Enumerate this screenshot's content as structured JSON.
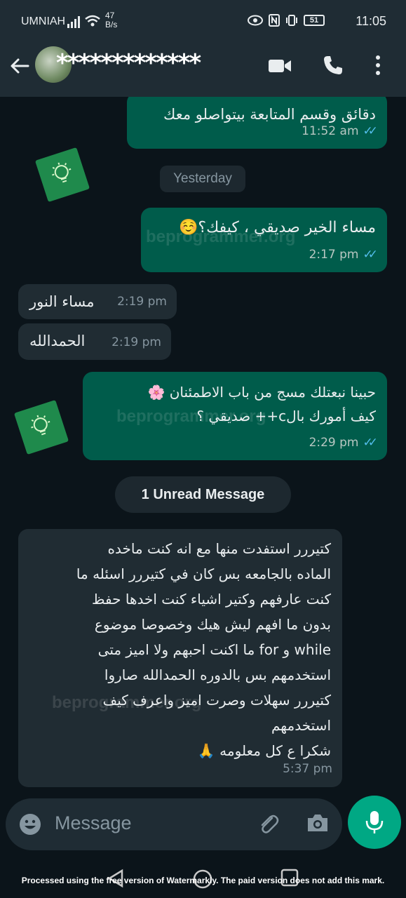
{
  "status_bar": {
    "carrier": "UMNIAH",
    "speed_value": "47",
    "speed_unit": "B/s",
    "battery": "51",
    "time": "11:05"
  },
  "header": {
    "contact_name": "*************",
    "back_icon": "arrow-left-icon",
    "video_icon": "video-call-icon",
    "phone_icon": "phone-icon",
    "menu_icon": "more-vert-icon"
  },
  "messages": [
    {
      "direction": "out",
      "text": "دقائق وقسم المتابعة بيتواصلو معك",
      "time": "11:52 am",
      "status": "read"
    },
    {
      "direction": "out",
      "text": "مساء الخير صديقي ، كيفك؟☺️",
      "time": "2:17 pm",
      "status": "read"
    },
    {
      "direction": "in",
      "text": "مساء النور",
      "time": "2:19 pm"
    },
    {
      "direction": "in",
      "text": "الحمدالله",
      "time": "2:19 pm"
    },
    {
      "direction": "out",
      "text_line1": "حبينا نبعتلك مسج من باب الاطمئنان 🌸",
      "text_line2": "كيف أمورك بالc++ صديقي ؟",
      "time": "2:29 pm",
      "status": "read"
    },
    {
      "direction": "in",
      "lines": [
        "كتيررر استفدت منها مع انه كنت ماخده",
        "الماده بالجامعه بس كان في كتيررر اسئله ما",
        "كنت عارفهم وكتير اشياء كنت اخدها حفظ",
        "بدون ما افهم ليش هيك  وخصوصا موضوع",
        "while  و  for   ما اكنت احبهم ولا اميز متى",
        "استخدمهم بس بالدوره الحمدالله صاروا",
        "كتيررر سهلات وصرت اميز واعرف كيف",
        "استخدمهم",
        "شكرا ع كل معلومه 🙏"
      ],
      "time": "5:37 pm"
    }
  ],
  "date_chip": "Yesterday",
  "unread_label": "1 Unread Message",
  "watermark_text": "beprogrammer.org",
  "input": {
    "placeholder": "Message"
  },
  "footer_note": "Processed using the free version of Watermarkly. The paid version does not add this mark.",
  "colors": {
    "background": "#0b141a",
    "bar": "#1f2c34",
    "outgoing_bubble": "#005c4b",
    "incoming_bubble": "#202c33",
    "accent": "#00a884",
    "read_ticks": "#53bdeb"
  }
}
